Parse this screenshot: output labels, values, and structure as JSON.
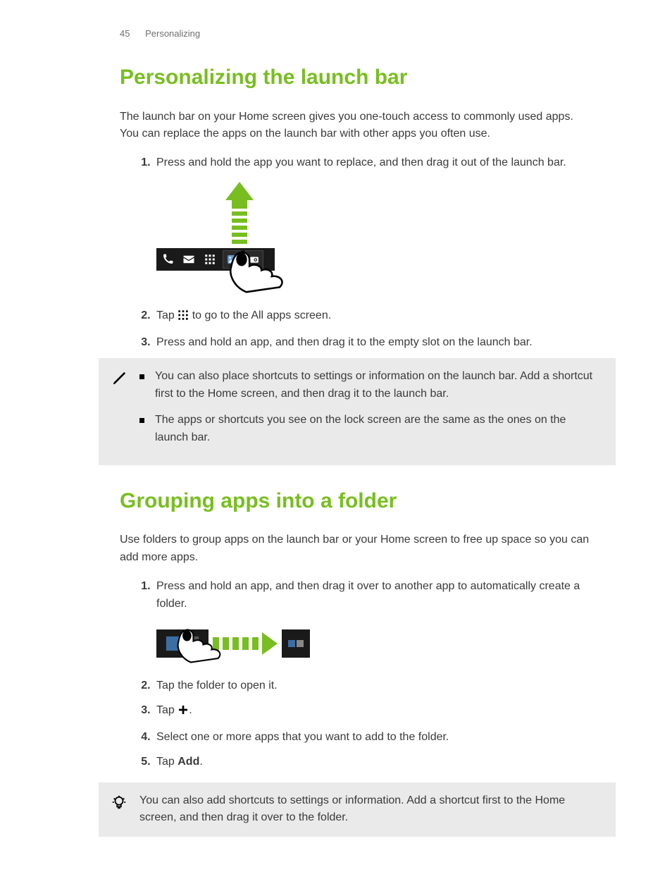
{
  "header": {
    "page_number": "45",
    "section": "Personalizing"
  },
  "section1": {
    "title": "Personalizing the launch bar",
    "intro": "The launch bar on your Home screen gives you one-touch access to commonly used apps. You can replace the apps on the launch bar with other apps you often use.",
    "steps": {
      "s1": "Press and hold the app you want to replace, and then drag it out of the launch bar.",
      "s2_pre": "Tap ",
      "s2_post": " to go to the All apps screen.",
      "s3": "Press and hold an app, and then drag it to the empty slot on the launch bar."
    },
    "note": {
      "b1": "You can also place shortcuts to settings or information on the launch bar. Add a shortcut first to the Home screen, and then drag it to the launch bar.",
      "b2": "The apps or shortcuts you see on the lock screen are the same as the ones on the launch bar."
    }
  },
  "section2": {
    "title": "Grouping apps into a folder",
    "intro": "Use folders to group apps on the launch bar or your Home screen to free up space so you can add more apps.",
    "steps": {
      "s1": "Press and hold an app, and then drag it over to another app to automatically create a folder.",
      "s2": "Tap the folder to open it.",
      "s3_pre": "Tap ",
      "s3_post": ".",
      "s4": "Select one or more apps that you want to add to the folder.",
      "s5_pre": "Tap ",
      "s5_bold": "Add",
      "s5_post": "."
    },
    "tip": "You can also add shortcuts to settings or information. Add a shortcut first to the Home screen, and then drag it over to the folder."
  }
}
